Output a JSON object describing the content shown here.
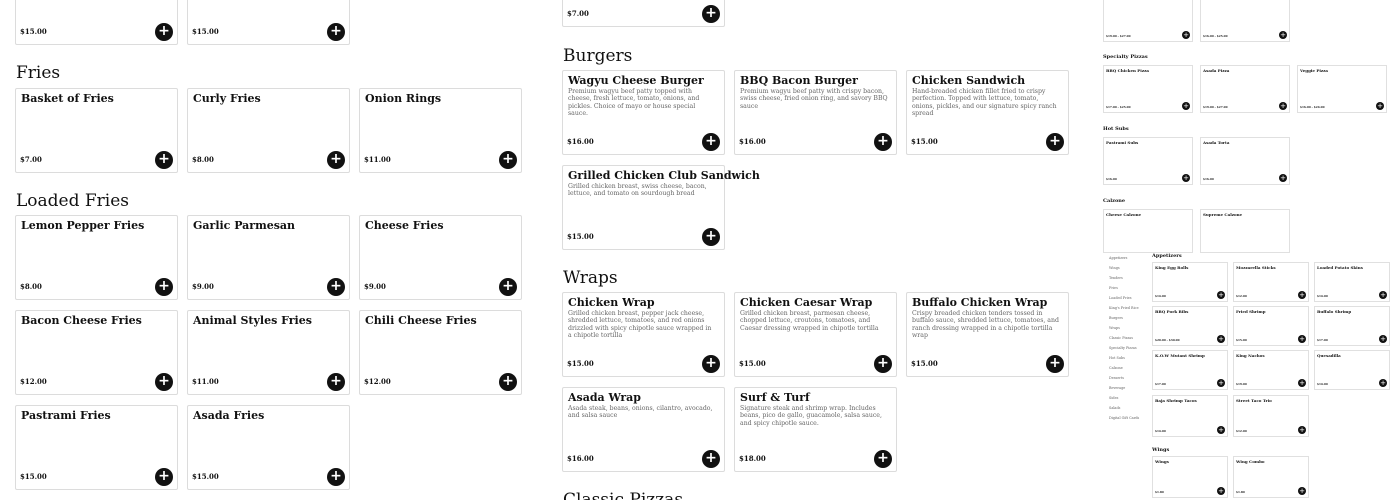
{
  "columns": {
    "left": {
      "top_prices": [
        "$15.00",
        "$15.00"
      ],
      "fries_title": "Fries",
      "fries": [
        {
          "name": "Basket of Fries",
          "price": "$7.00"
        },
        {
          "name": "Curly Fries",
          "price": "$8.00"
        },
        {
          "name": "Onion Rings",
          "price": "$11.00"
        }
      ],
      "loaded_title": "Loaded Fries",
      "loaded": [
        {
          "name": "Lemon Pepper Fries",
          "price": "$8.00"
        },
        {
          "name": "Garlic Parmesan",
          "price": "$9.00"
        },
        {
          "name": "Cheese Fries",
          "price": "$9.00"
        },
        {
          "name": "Bacon Cheese Fries",
          "price": "$12.00"
        },
        {
          "name": "Animal Styles Fries",
          "price": "$11.00"
        },
        {
          "name": "Chili Cheese Fries",
          "price": "$12.00"
        },
        {
          "name": "Pastrami Fries",
          "price": "$15.00"
        },
        {
          "name": "Asada Fries",
          "price": "$15.00"
        }
      ]
    },
    "middle": {
      "top_price": "$7.00",
      "burgers_title": "Burgers",
      "burgers": [
        {
          "name": "Wagyu Cheese Burger",
          "desc": "Premium wagyu beef patty topped with cheese, fresh lettuce, tomato, onions, and pickles. Choice of mayo or house special sauce.",
          "price": "$16.00"
        },
        {
          "name": "BBQ Bacon Burger",
          "desc": "Premium wagyu beef patty with crispy bacon, swiss cheese, fried onion ring, and savory BBQ sauce",
          "price": "$16.00"
        },
        {
          "name": "Chicken Sandwich",
          "desc": "Hand-breaded chicken fillet fried to crispy perfection. Topped with lettuce, tomato, onions, pickles, and our signature spicy ranch spread",
          "price": "$15.00"
        },
        {
          "name": "Grilled Chicken Club Sandwich",
          "desc": "Grilled chicken breast, swiss cheese, bacon, lettuce, and tomato on sourdough bread",
          "price": "$15.00"
        }
      ],
      "wraps_title": "Wraps",
      "wraps": [
        {
          "name": "Chicken Wrap",
          "desc": "Grilled chicken breast, pepper jack cheese, shredded lettuce, tomatoes, and red onions drizzled with spicy chipotle sauce wrapped in a chipotle tortilla",
          "price": "$15.00"
        },
        {
          "name": "Chicken Caesar Wrap",
          "desc": "Grilled chicken breast, parmesan cheese, chopped lettuce, croutons, tomatoes, and Caesar dressing wrapped in chipotle tortilla",
          "price": "$15.00"
        },
        {
          "name": "Buffalo Chicken Wrap",
          "desc": "Crispy breaded chicken tenders tossed in buffalo sauce, shredded lettuce, tomatoes, and ranch dressing wrapped in a chipotle tortilla wrap",
          "price": "$15.00"
        },
        {
          "name": "Asada Wrap",
          "desc": "Asada steak, beans, onions, cilantro, avocado, and salsa sauce",
          "price": "$16.00"
        },
        {
          "name": "Surf & Turf",
          "desc": "Signature steak and shrimp wrap. Includes beans, pico de gallo, guacamole, salsa sauce, and spicy chipotle sauce.",
          "price": "$18.00"
        }
      ],
      "classic_title": "Classic Pizzas"
    },
    "right_top": {
      "top_prices": [
        "$19.00 - $27.00",
        "$16.00 - $25.00"
      ],
      "specialty_title": "Specialty Pizzas",
      "specialty": [
        {
          "name": "BBQ Chicken Pizza",
          "price": "$17.00 - $25.00"
        },
        {
          "name": "Asada Pizza",
          "price": "$19.00 - $27.00"
        },
        {
          "name": "Veggie Pizza",
          "price": "$16.00 - $24.00"
        }
      ],
      "subs_title": "Hot Subs",
      "subs": [
        {
          "name": "Pastrami Subs",
          "price": "$16.00"
        },
        {
          "name": "Asada Torta",
          "price": "$16.00"
        }
      ],
      "calzone_title": "Calzone",
      "calzones": [
        {
          "name": "Cheese Calzone"
        },
        {
          "name": "Supreme Calzone"
        }
      ]
    },
    "right_bottom": {
      "nav": [
        "Appetizers",
        "Wings",
        "Tenders",
        "Fries",
        "Loaded Fries",
        "King's Fried Rice",
        "Burgers",
        "Wraps",
        "Classic Pizzas",
        "Specialty Pizzas",
        "Hot Subs",
        "Calzone",
        "Desserts",
        "Beverage",
        "Sides",
        "Salads",
        "Digital Gift Cards"
      ],
      "appetizers_title": "Appetizers",
      "appetizers": [
        {
          "name": "King Egg Rolls",
          "price": "$14.00"
        },
        {
          "name": "Mozzarella Sticks",
          "price": "$12.00"
        },
        {
          "name": "Loaded Potato Skins",
          "price": "$14.00"
        },
        {
          "name": "BBQ Pork Ribs",
          "price": "$20.00 - $30.00"
        },
        {
          "name": "Fried Shrimp",
          "price": "$15.00"
        },
        {
          "name": "Buffalo Shrimp",
          "price": "$17.00"
        },
        {
          "name": "K.O.W Mutant Shrimp",
          "price": "$17.00"
        },
        {
          "name": "King Nachos",
          "price": "$19.00"
        },
        {
          "name": "Quesadilla",
          "price": "$14.00"
        },
        {
          "name": "Baja Shrimp Tacos",
          "price": "$14.00"
        },
        {
          "name": "Street Taco Trio",
          "price": "$12.00"
        }
      ],
      "wings_title": "Wings",
      "wings": [
        {
          "name": "Wings",
          "price": "$1.80"
        },
        {
          "name": "Wing Combo",
          "price": "$1.80"
        }
      ]
    }
  },
  "add_symbol": "+"
}
